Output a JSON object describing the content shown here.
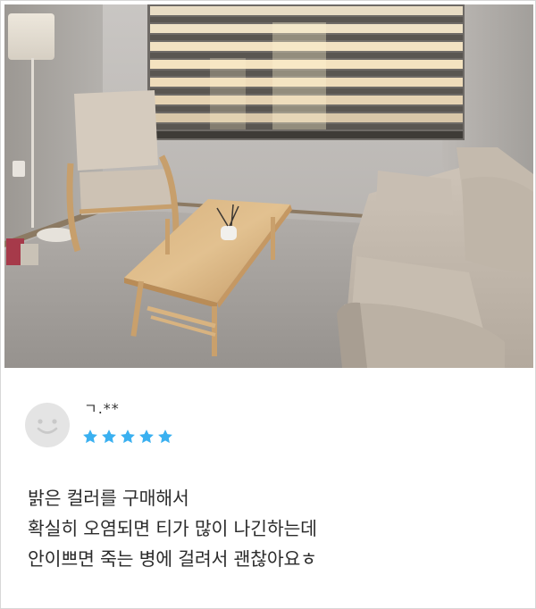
{
  "review": {
    "reviewer_name": "ㄱ.**",
    "rating": 5,
    "rating_max": 5,
    "body_lines": [
      "밝은 컬러를 구매해서",
      "확실히 오염되면 티가 많이 나긴하는데",
      "안이쁘면 죽는 병에 걸려서 괜찮아요ㅎ"
    ]
  },
  "colors": {
    "star": "#3ab0f0",
    "avatar_bg": "#e4e4e4",
    "avatar_face": "#c9c9c9",
    "text": "#2b2b2b"
  },
  "icons": {
    "avatar": "smiley-face-icon",
    "star": "star-icon"
  }
}
